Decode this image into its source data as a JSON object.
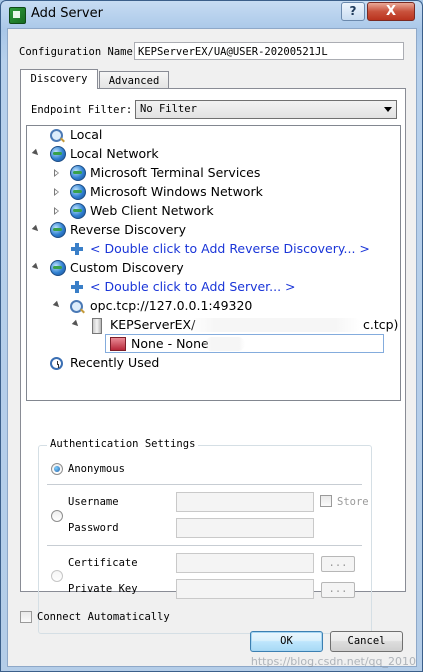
{
  "window": {
    "title": "Add Server",
    "help_label": "?",
    "close_label": "X"
  },
  "config": {
    "label": "Configuration Name",
    "value": "KEPServerEX/UA@USER-20200521JL"
  },
  "tabs": [
    {
      "label": "Discovery",
      "active": true
    },
    {
      "label": "Advanced",
      "active": false
    }
  ],
  "filter": {
    "label": "Endpoint Filter:",
    "value": "No Filter"
  },
  "tree": {
    "local": "Local",
    "local_network": "Local Network",
    "terminal_services": "Microsoft Terminal Services",
    "windows_network": "Microsoft Windows Network",
    "web_client_network": "Web Client Network",
    "reverse_discovery": "Reverse Discovery",
    "add_reverse": "< Double click to Add Reverse Discovery... >",
    "custom_discovery": "Custom Discovery",
    "add_server": "< Double click to Add Server... >",
    "opc_endpoint": "opc.tcp://127.0.0.1:49320",
    "kepserver_prefix": "KEPServerEX/",
    "kepserver_suffix": "c.tcp)",
    "none_none": "None - None",
    "recently_used": "Recently Used"
  },
  "auth": {
    "title": "Authentication Settings",
    "anonymous": "Anonymous",
    "username": "Username",
    "password": "Password",
    "store": "Store",
    "certificate": "Certificate",
    "private_key": "Private Key",
    "browse": "..."
  },
  "footer": {
    "connect_auto": "Connect Automatically",
    "ok": "OK",
    "cancel": "Cancel"
  },
  "watermark": "https://blog.csdn.net/qq_2010"
}
